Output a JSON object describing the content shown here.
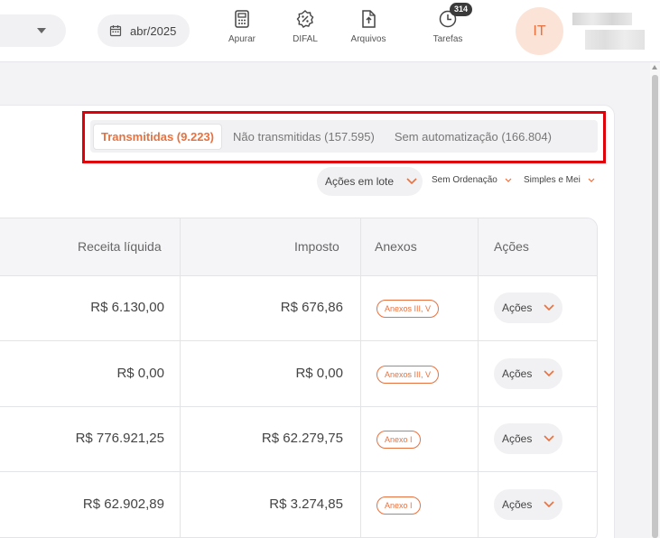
{
  "header": {
    "date_filter": "abr/2025",
    "nav": [
      {
        "label": "Apurar",
        "icon": "calculator-icon"
      },
      {
        "label": "DIFAL",
        "icon": "percent-badge-icon"
      },
      {
        "label": "Arquivos",
        "icon": "file-upload-icon"
      },
      {
        "label": "Tarefas",
        "icon": "clock-icon",
        "badge": "314"
      }
    ],
    "avatar_initials": "IT"
  },
  "tabs": [
    {
      "label": "Transmitidas (9.223)",
      "active": true
    },
    {
      "label": "Não transmitidas (157.595)",
      "active": false
    },
    {
      "label": "Sem automatização (166.804)",
      "active": false
    }
  ],
  "toolbar": {
    "batch_actions": "Ações em lote",
    "sort": "Sem Ordenação",
    "regime": "Simples e Mei"
  },
  "table": {
    "headers": [
      "Receita líquida",
      "Imposto",
      "Anexos",
      "Ações"
    ],
    "rows": [
      {
        "receita": "R$ 6.130,00",
        "imposto": "R$ 676,86",
        "anexos": "Anexos III, V",
        "acoes": "Ações"
      },
      {
        "receita": "R$ 0,00",
        "imposto": "R$ 0,00",
        "anexos": "Anexos III, V",
        "acoes": "Ações"
      },
      {
        "receita": "R$ 776.921,25",
        "imposto": "R$ 62.279,75",
        "anexos": "Anexo I",
        "acoes": "Ações"
      },
      {
        "receita": "R$ 62.902,89",
        "imposto": "R$ 3.274,85",
        "anexos": "Anexo I",
        "acoes": "Ações"
      }
    ]
  },
  "colors": {
    "accent": "#e8713f",
    "highlight": "#e0000a"
  }
}
